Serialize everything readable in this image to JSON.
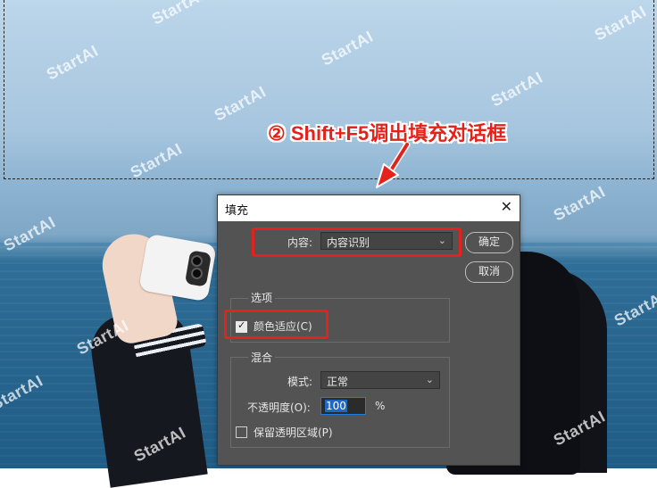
{
  "annotation": {
    "text": "② Shift+F5调出填充对话框"
  },
  "watermark": {
    "text": "StartAI"
  },
  "dialog": {
    "title": "填充",
    "close_glyph": "✕",
    "content_label": "内容:",
    "content_value": "内容识别",
    "ok_label": "确定",
    "cancel_label": "取消",
    "options_group": "选项",
    "color_adapt_label": "颜色适应(C)",
    "color_adapt_checked": true,
    "blend_group": "混合",
    "mode_label": "模式:",
    "mode_value": "正常",
    "opacity_label": "不透明度(O):",
    "opacity_value": "100",
    "opacity_unit": "%",
    "preserve_label": "保留透明区域(P)",
    "preserve_checked": false,
    "chevron_icon": "chevron-down-icon"
  },
  "colors": {
    "annotation_red": "#e3231b",
    "dialog_bg": "#535353",
    "input_focus": "#1f7de0"
  }
}
